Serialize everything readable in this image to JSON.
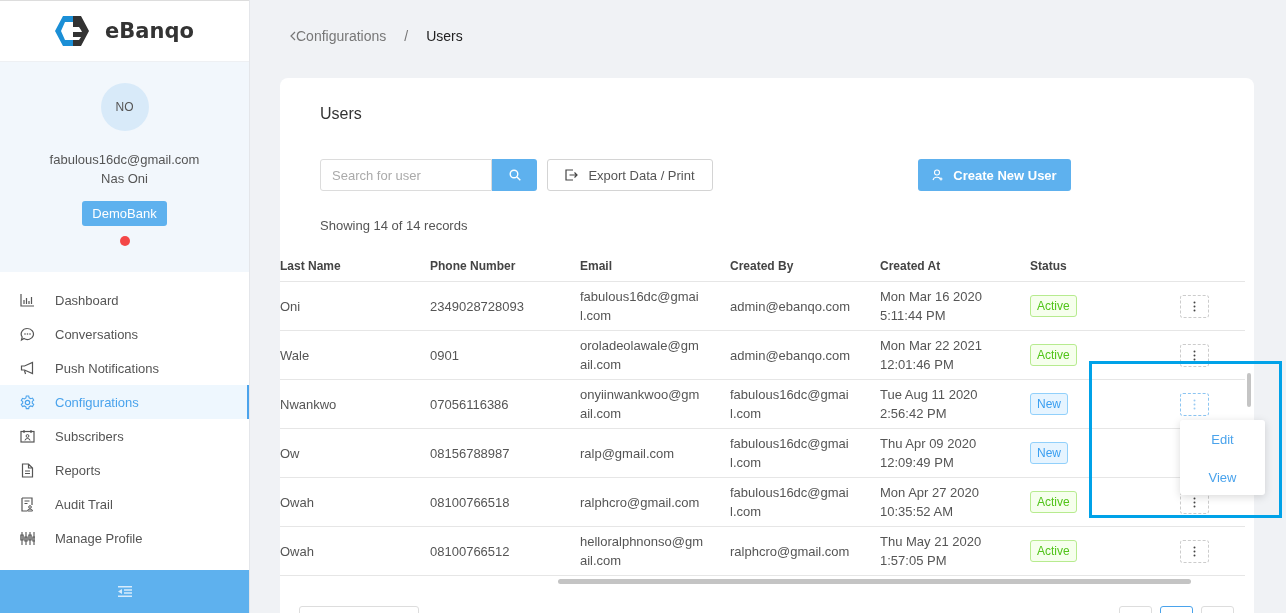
{
  "brand": {
    "name": "eBanqo"
  },
  "profile": {
    "initials": "NO",
    "email": "fabulous16dc@gmail.com",
    "name": "Nas Oni",
    "bank": "DemoBank",
    "online": false
  },
  "nav": [
    {
      "label": "Dashboard",
      "selected": false
    },
    {
      "label": "Conversations",
      "selected": false
    },
    {
      "label": "Push Notifications",
      "selected": false
    },
    {
      "label": "Configurations",
      "selected": true
    },
    {
      "label": "Subscribers",
      "selected": false
    },
    {
      "label": "Reports",
      "selected": false
    },
    {
      "label": "Audit Trail",
      "selected": false
    },
    {
      "label": "Manage Profile",
      "selected": false
    }
  ],
  "breadcrumb": {
    "parent": "Configurations",
    "separator": "/",
    "current": "Users"
  },
  "card": {
    "title": "Users",
    "search": {
      "placeholder": "Search for user"
    },
    "export_button": "Export Data / Print",
    "create_button": "Create New User",
    "records": "Showing 14 of 14 records"
  },
  "table": {
    "columns": [
      "Last Name",
      "Phone Number",
      "Email",
      "Created By",
      "Created At",
      "Status"
    ],
    "rows": [
      {
        "cells": [
          "Oni",
          "2349028728093",
          "fabulous16dc@gmail.com",
          "admin@ebanqo.com",
          "Mon Mar 16 2020 5:11:44 PM"
        ],
        "status": {
          "label": "Active",
          "kind": "active"
        },
        "menu_open": false
      },
      {
        "cells": [
          "Wale",
          "0901",
          "oroladeolawale@gmail.com",
          "admin@ebanqo.com",
          "Mon Mar 22 2021 12:01:46 PM"
        ],
        "status": {
          "label": "Active",
          "kind": "active"
        },
        "menu_open": false
      },
      {
        "cells": [
          "Nwankwo",
          "07056116386",
          "onyiinwankwoo@gmail.com",
          "fabulous16dc@gmail.com",
          "Tue Aug 11 2020 2:56:42 PM"
        ],
        "status": {
          "label": "New",
          "kind": "new"
        },
        "menu_open": true
      },
      {
        "cells": [
          "Ow",
          "08156788987",
          "ralp@gmail.com",
          "fabulous16dc@gmail.com",
          "Thu Apr 09 2020 12:09:49 PM"
        ],
        "status": {
          "label": "New",
          "kind": "new"
        },
        "menu_open": false
      },
      {
        "cells": [
          "Owah",
          "08100766518",
          "ralphcro@gmail.com",
          "fabulous16dc@gmail.com",
          "Mon Apr 27 2020 10:35:52 AM"
        ],
        "status": {
          "label": "Active",
          "kind": "active"
        },
        "menu_open": false
      },
      {
        "cells": [
          "Owah",
          "08100766512",
          "helloralphnonso@gmail.com",
          "ralphcro@gmail.com",
          "Thu May 21 2020 1:57:05 PM"
        ],
        "status": {
          "label": "Active",
          "kind": "active"
        },
        "menu_open": false
      }
    ],
    "row_menu": [
      "Edit",
      "View"
    ]
  }
}
